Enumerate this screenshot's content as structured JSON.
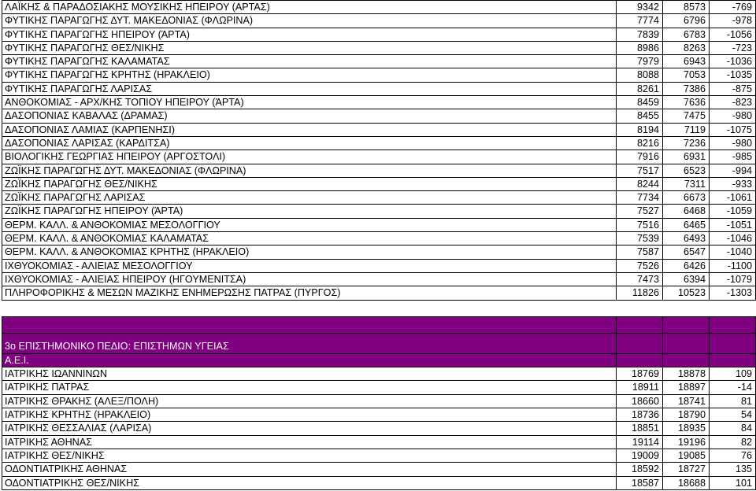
{
  "rows_top": [
    {
      "name": "ΛΑΪΚΗΣ & ΠΑΡΑΔΟΣΙΑΚΗΣ ΜΟΥΣΙΚΗΣ ΗΠΕΙΡΟΥ (ΑΡΤΑΣ)",
      "a": "9342",
      "b": "8573",
      "c": "-769"
    },
    {
      "name": "ΦΥΤΙΚΗΣ ΠΑΡΑΓΩΓΗΣ ΔΥΤ. ΜΑΚΕΔΟΝΙΑΣ (ΦΛΩΡΙΝΑ)",
      "a": "7774",
      "b": "6796",
      "c": "-978"
    },
    {
      "name": "ΦΥΤΙΚΗΣ ΠΑΡΑΓΩΓΗΣ ΗΠΕΙΡΟΥ (ΆΡΤΑ)",
      "a": "7839",
      "b": "6783",
      "c": "-1056"
    },
    {
      "name": "ΦΥΤΙΚΗΣ ΠΑΡΑΓΩΓΗΣ ΘΕΣ/ΝΙΚΗΣ",
      "a": "8986",
      "b": "8263",
      "c": "-723"
    },
    {
      "name": "ΦΥΤΙΚΗΣ ΠΑΡΑΓΩΓΗΣ ΚΑΛΑΜΑΤΑΣ",
      "a": "7979",
      "b": "6943",
      "c": "-1036"
    },
    {
      "name": "ΦΥΤΙΚΗΣ ΠΑΡΑΓΩΓΗΣ ΚΡΗΤΗΣ (ΗΡΑΚΛΕΙΟ)",
      "a": "8088",
      "b": "7053",
      "c": "-1035"
    },
    {
      "name": "ΦΥΤΙΚΗΣ ΠΑΡΑΓΩΓΗΣ ΛΑΡΙΣΑΣ",
      "a": "8261",
      "b": "7386",
      "c": "-875"
    },
    {
      "name": "ΑΝΘΟΚΟΜΙΑΣ - ΑΡΧ/ΚΗΣ ΤΟΠΙΟΥ ΗΠΕΙΡΟΥ (ΆΡΤΑ)",
      "a": "8459",
      "b": "7636",
      "c": "-823"
    },
    {
      "name": "ΔΑΣΟΠΟΝΙΑΣ ΚΑΒΑΛΑΣ (ΔΡΑΜΑΣ)",
      "a": "8455",
      "b": "7475",
      "c": "-980"
    },
    {
      "name": "ΔΑΣΟΠΟΝΙΑΣ ΛΑΜΙΑΣ (ΚΑΡΠΕΝΗΣΙ)",
      "a": "8194",
      "b": "7119",
      "c": "-1075"
    },
    {
      "name": "ΔΑΣΟΠΟΝΙΑΣ ΛΑΡΙΣΑΣ (ΚΑΡΔΙΤΣΑ)",
      "a": "8216",
      "b": "7236",
      "c": "-980"
    },
    {
      "name": "ΒΙΟΛΟΓΙΚΗΣ ΓΕΩΡΓΙΑΣ ΗΠΕΙΡΟΥ (ΑΡΓΟΣΤΟΛΙ)",
      "a": "7916",
      "b": "6931",
      "c": "-985"
    },
    {
      "name": "ΖΩΪΚΗΣ ΠΑΡΑΓΩΓΗΣ ΔΥΤ. ΜΑΚΕΔΟΝΙΑΣ (ΦΛΩΡΙΝΑ)",
      "a": "7517",
      "b": "6523",
      "c": "-994"
    },
    {
      "name": "ΖΩΪΚΗΣ ΠΑΡΑΓΩΓΗΣ ΘΕΣ/ΝΙΚΗΣ",
      "a": "8244",
      "b": "7311",
      "c": "-933"
    },
    {
      "name": "ΖΩΪΚΗΣ ΠΑΡΑΓΩΓΗΣ ΛΑΡΙΣΑΣ",
      "a": "7734",
      "b": "6673",
      "c": "-1061"
    },
    {
      "name": "ΖΩΪΚΗΣ ΠΑΡΑΓΩΓΗΣ ΗΠΕΙΡΟΥ (ΆΡΤΑ)",
      "a": "7527",
      "b": "6468",
      "c": "-1059"
    },
    {
      "name": "ΘΕΡΜ. ΚΑΛΛ. & ΑΝΘΟΚΟΜΙΑΣ ΜΕΣΟΛΟΓΓΙΟΥ",
      "a": "7516",
      "b": "6465",
      "c": "-1051"
    },
    {
      "name": "ΘΕΡΜ. ΚΑΛΛ. & ΑΝΘΟΚΟΜΙΑΣ ΚΑΛΑΜΑΤΑΣ",
      "a": "7539",
      "b": "6493",
      "c": "-1046"
    },
    {
      "name": "ΘΕΡΜ. ΚΑΛΛ. & ΑΝΘΟΚΟΜΙΑΣ ΚΡΗΤΗΣ (ΗΡΑΚΛΕΙΟ)",
      "a": "7587",
      "b": "6547",
      "c": "-1040"
    },
    {
      "name": "ΙΧΘΥΟΚΟΜΙΑΣ - ΑΛΙΕΙΑΣ ΜΕΣΟΛΟΓΓΙΟΥ",
      "a": "7526",
      "b": "6426",
      "c": "-1100"
    },
    {
      "name": "ΙΧΘΥΟΚΟΜΙΑΣ - ΑΛΙΕΙΑΣ ΗΠΕΙΡΟΥ (ΗΓΟΥΜΕΝΙΤΣΑ)",
      "a": "7473",
      "b": "6394",
      "c": "-1079"
    },
    {
      "name": "ΠΛΗΡΟΦΟΡΙΚΗΣ & ΜΕΣΩΝ ΜΑΖΙΚΗΣ ΕΝΗΜΕΡΩΣΗΣ ΠΑΤΡΑΣ (ΠΥΡΓΟΣ)",
      "a": "11826",
      "b": "10523",
      "c": "-1303"
    }
  ],
  "section": {
    "title": "3ο ΕΠΙΣΤΗΜΟΝΙΚΟ ΠΕΔΙΟ: ΕΠΙΣΤΗΜΩΝ ΥΓΕΙΑΣ",
    "subtitle": "Α.Ε.Ι.",
    "color": "#800080"
  },
  "rows_bottom": [
    {
      "name": "ΙΑΤΡΙΚΗΣ ΙΩΑΝΝΙΝΩΝ",
      "a": "18769",
      "b": "18878",
      "c": "109"
    },
    {
      "name": "ΙΑΤΡΙΚΗΣ ΠΑΤΡΑΣ",
      "a": "18911",
      "b": "18897",
      "c": "-14"
    },
    {
      "name": "ΙΑΤΡΙΚΗΣ ΘΡΑΚΗΣ (ΑΛΕΞ/ΠΟΛΗ)",
      "a": "18660",
      "b": "18741",
      "c": "81"
    },
    {
      "name": "ΙΑΤΡΙΚΗΣ ΚΡΗΤΗΣ (ΗΡΑΚΛΕΙΟ)",
      "a": "18736",
      "b": "18790",
      "c": "54"
    },
    {
      "name": "ΙΑΤΡΙΚΗΣ ΘΕΣΣΑΛΙΑΣ (ΛΑΡΙΣΑ)",
      "a": "18851",
      "b": "18935",
      "c": "84"
    },
    {
      "name": "ΙΑΤΡΙΚΗΣ ΑΘΗΝΑΣ",
      "a": "19114",
      "b": "19196",
      "c": "82"
    },
    {
      "name": "ΙΑΤΡΙΚΗΣ ΘΕΣ/ΝΙΚΗΣ",
      "a": "19009",
      "b": "19085",
      "c": "76"
    },
    {
      "name": "ΟΔΟΝΤΙΑΤΡΙΚΗΣ ΑΘΗΝΑΣ",
      "a": "18592",
      "b": "18727",
      "c": "135"
    },
    {
      "name": "ΟΔΟΝΤΙΑΤΡΙΚΗΣ ΘΕΣ/ΝΙΚΗΣ",
      "a": "18587",
      "b": "18688",
      "c": "101"
    }
  ]
}
